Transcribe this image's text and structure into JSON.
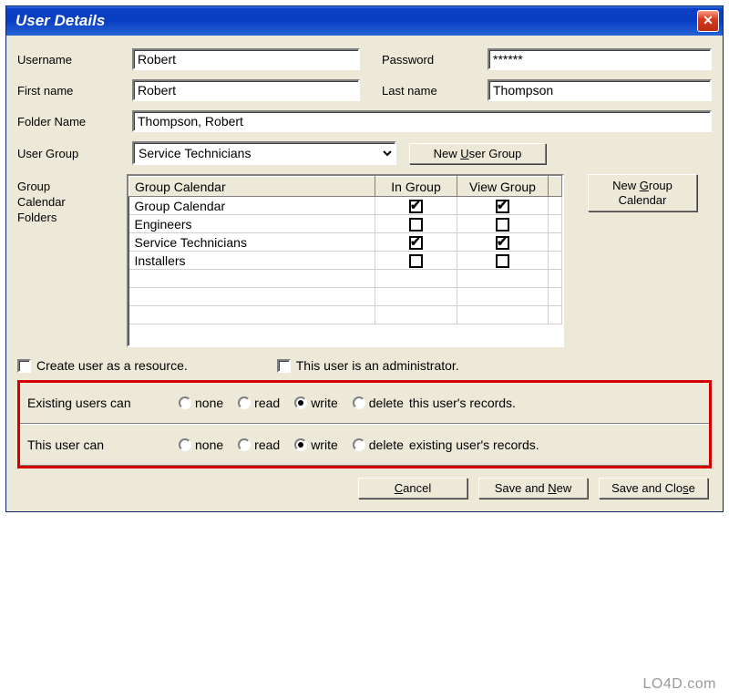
{
  "window": {
    "title": "User Details"
  },
  "labels": {
    "username": "Username",
    "password": "Password",
    "firstname": "First name",
    "lastname": "Last name",
    "folder": "Folder Name",
    "usergroup": "User Group",
    "gcf": "Group\nCalendar\nFolders",
    "new_ug_pre": "New ",
    "new_ug_u": "U",
    "new_ug_post": "ser Group",
    "new_gc_pre": "New ",
    "new_gc_u": "G",
    "new_gc_post": "roup\nCalendar",
    "create_res": "Create user as a resource.",
    "is_admin": "This user is an administrator.",
    "existing_pre": "Existing users can",
    "existing_post": "  this user's records.",
    "thisuser_pre": "This user can",
    "thisuser_post": "  existing user's records.",
    "r_none": "none",
    "r_read": "read",
    "r_write": "write",
    "r_delete": "delete",
    "cancel_u": "C",
    "cancel_post": "ancel",
    "saven_pre": "Save and ",
    "saven_u": "N",
    "saven_post": "ew",
    "savec_pre": "Save and Clo",
    "savec_u": "s",
    "savec_post": "e"
  },
  "fields": {
    "username": "Robert",
    "password": "******",
    "firstname": "Robert",
    "lastname": "Thompson",
    "folder": "Thompson, Robert",
    "usergroup": "Service Technicians"
  },
  "grid": {
    "headers": {
      "name": "Group Calendar",
      "in": "In Group",
      "view": "View Group"
    },
    "rows": [
      {
        "name": "Group Calendar",
        "in": true,
        "view": true
      },
      {
        "name": "Engineers",
        "in": false,
        "view": false
      },
      {
        "name": "Service Technicians",
        "in": true,
        "view": true
      },
      {
        "name": "Installers",
        "in": false,
        "view": false
      }
    ]
  },
  "checks": {
    "resource": false,
    "admin": false
  },
  "perms": {
    "existing": "write",
    "thisuser": "write"
  },
  "watermark": "LO4D.com"
}
